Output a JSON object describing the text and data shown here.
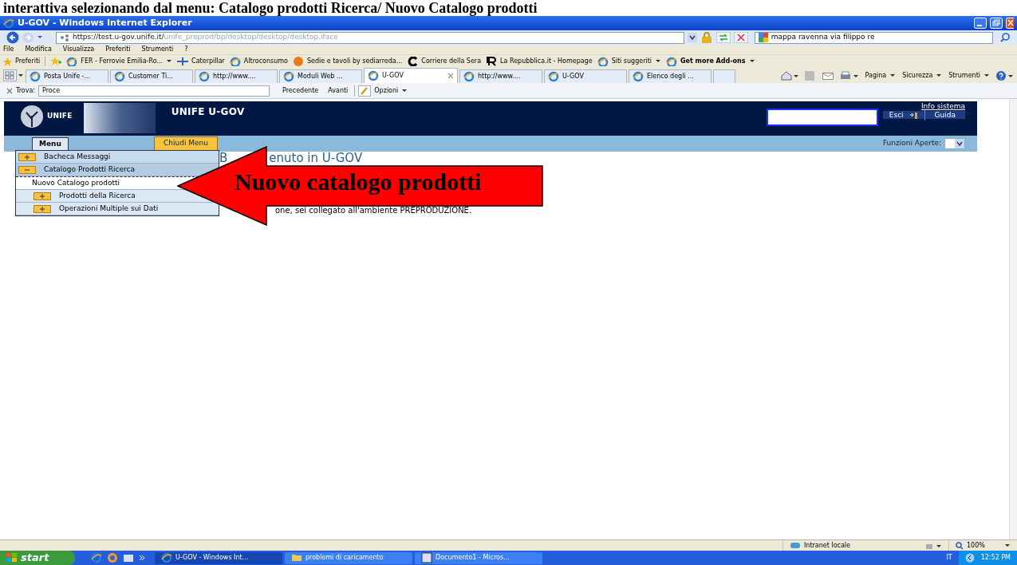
{
  "caption": "interattiva selezionando dal menu: Catalogo prodotti Ricerca/ Nuovo Catalogo prodotti",
  "window": {
    "title": "U-GOV - Windows Internet Explorer"
  },
  "address_bar": {
    "url_host": "https://test.u-gov.unife.it/",
    "url_path": "unife_preprod/bp/desktop/desktop/desktop.iface",
    "search_value": "mappa ravenna via filippo re"
  },
  "menu_bar": [
    "File",
    "Modifica",
    "Visualizza",
    "Preferiti",
    "Strumenti",
    "?"
  ],
  "favorites": {
    "label": "Preferiti",
    "items": [
      {
        "label": "FER - Ferrovie Emilia-Ro...",
        "dropdown": true,
        "bold": false
      },
      {
        "label": "Caterpillar",
        "dropdown": false,
        "bold": false
      },
      {
        "label": "Altroconsumo",
        "dropdown": false,
        "bold": false
      },
      {
        "label": "Sedie e tavoli by sediarreda...",
        "dropdown": false,
        "bold": false
      },
      {
        "label": "Corriere della Sera",
        "dropdown": false,
        "bold": false
      },
      {
        "label": "La Repubblica.it - Homepage",
        "dropdown": false,
        "bold": false
      },
      {
        "label": "Siti suggeriti",
        "dropdown": true,
        "bold": false
      },
      {
        "label": "Get more Add-ons",
        "dropdown": true,
        "bold": true
      }
    ]
  },
  "tabs": [
    {
      "label": "Posta Unife -...",
      "selected": false
    },
    {
      "label": "Customer Ti...",
      "selected": false
    },
    {
      "label": "http://www....",
      "selected": false
    },
    {
      "label": "Moduli Web ...",
      "selected": false
    },
    {
      "label": "U-GOV",
      "selected": true
    },
    {
      "label": "http://www....",
      "selected": false
    },
    {
      "label": "U-GOV",
      "selected": false
    },
    {
      "label": "Elenco degli ...",
      "selected": false
    }
  ],
  "command_bar": [
    "Pagina",
    "Sicurezza",
    "Strumenti"
  ],
  "find_bar": {
    "label": "Trova:",
    "value": "Proce",
    "previous": "Precedente",
    "next": "Avanti",
    "options": "Opzioni"
  },
  "app": {
    "title": "UNIFE U-GOV",
    "logo_text": "UNIFE",
    "info_link": "Info sistema",
    "exit": "Esci",
    "help": "Guida",
    "open_functions": "Funzioni Aperte:",
    "menu_tab": "Menu",
    "close_menu": "Chiudi Menu",
    "menu_items": [
      {
        "label": "Bacheca Messaggi",
        "expanded": false
      },
      {
        "label": "Catalogo Prodotti Ricerca",
        "expanded": true,
        "children": [
          {
            "label": "Nuovo Catalogo prodotti",
            "kind": "leaf"
          },
          {
            "label": "Prodotti della Ricerca",
            "kind": "folder",
            "expanded": false
          },
          {
            "label": "Operazioni Multiple sui Dati",
            "kind": "folder",
            "expanded": false
          }
        ]
      }
    ],
    "welcome_start": "B",
    "welcome_rest": "enuto in U-GOV",
    "notice": "one, sei collegato all'ambiente PREPRODUZIONE."
  },
  "callout": {
    "text": "Nuovo catalogo prodotti"
  },
  "status_bar": {
    "zone": "Intranet locale",
    "zoom": "100%"
  },
  "taskbar": {
    "start": "start",
    "buttons": [
      {
        "label": "U-GOV - Windows Int...",
        "selected": true,
        "kind": "browser"
      },
      {
        "label": "problemi di caricamento",
        "selected": false,
        "kind": "folder"
      },
      {
        "label": "Documento1 - Micros...",
        "selected": false,
        "kind": "document"
      }
    ],
    "language": "IT",
    "time": "12:52 PM"
  }
}
